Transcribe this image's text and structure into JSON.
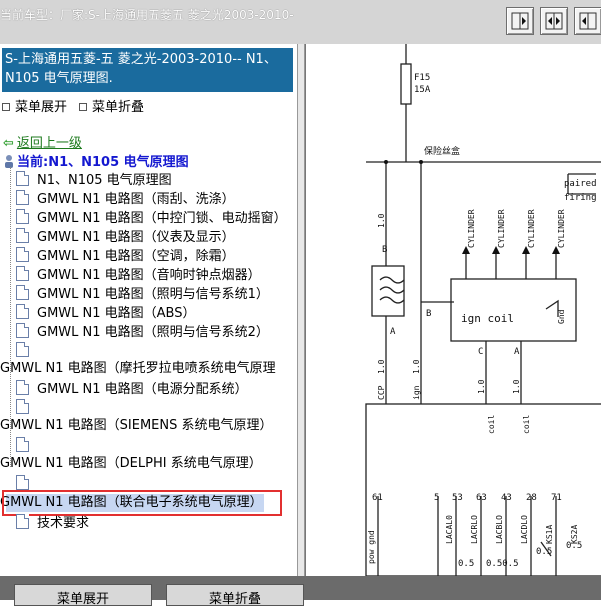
{
  "header": {
    "car_model": "当前车型：厂家:S-上海通用五菱五 菱之光2003-2010-"
  },
  "left_panel": {
    "title": "S-上海通用五菱-五 菱之光-2003-2010-- N1、N105 电气原理图.",
    "expand_label": "菜单展开",
    "collapse_label": "菜单折叠",
    "back_label": "返回上一级",
    "back_arrow": "⇦",
    "current_label": "当前:N1、N105 电气原理图",
    "items": [
      "N1、N105 电气原理图",
      "GMWL N1 电路图（雨刮、洗涤）",
      "GMWL N1 电路图（中控门锁、电动摇窗）",
      "GMWL N1 电路图（仪表及显示）",
      "GMWL N1 电路图（空调，除霜）",
      "GMWL N1 电路图（音响时钟点烟器）",
      "GMWL N1 电路图（照明与信号系统1）",
      "GMWL N1 电路图（ABS）",
      "GMWL N1 电路图（照明与信号系统2）"
    ],
    "group1": "GMWL N1 电路图（摩托罗拉电喷系统电气原理",
    "group1_child": "GMWL N1 电路图（电源分配系统）",
    "group2": "GMWL N1 电路图（SIEMENS 系统电气原理）",
    "group3": "GMWL N1 电路图（DELPHI 系统电气原理）",
    "group4": "GMWL N1 电路图（联合电子系统电气原理）",
    "last_item": "技术要求"
  },
  "diagram": {
    "fuse_label": "F15",
    "fuse_amp": "15A",
    "power_label": "保险丝盒",
    "paired_label": "paired",
    "firing_label": "firing",
    "coil_labels": [
      "CYLINDER",
      "CYLINDER",
      "CYLINDER",
      "CYLINDER"
    ],
    "ign_coil": "ign coil",
    "gnd": "Gnd",
    "wire_10": "1.0",
    "pin_b": "B",
    "pin_a": "A",
    "pin_c": "C",
    "ccp": "CCP",
    "ign": "ign",
    "coil": "coil",
    "pins": [
      "61",
      "5",
      "53",
      "63",
      "43",
      "28",
      "71"
    ],
    "bottom_labels": [
      "pow gnd",
      "LACAL0",
      "LACRLO",
      "LACBLO",
      "LACDLO",
      "KS1A",
      "KS2A"
    ],
    "values": [
      "0.5",
      "0.50.5",
      "0.50.5",
      "0.5"
    ]
  },
  "footer": {
    "expand_button": "菜单展开",
    "collapse_button": "菜单折叠"
  }
}
